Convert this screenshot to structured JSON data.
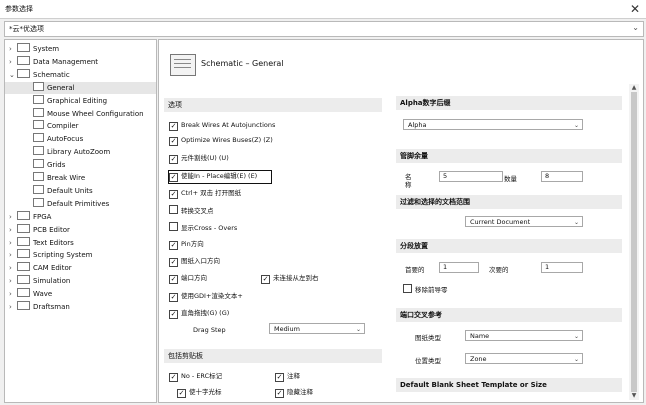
{
  "window": {
    "title": "参数选择",
    "close_glyph": "✕"
  },
  "search": {
    "value": "*云*优选项",
    "dropdown": "⌄"
  },
  "tree": {
    "items": [
      {
        "label": "System",
        "level": 0,
        "expanded": false,
        "kind": "folder"
      },
      {
        "label": "Data Management",
        "level": 0,
        "expanded": false,
        "kind": "folder"
      },
      {
        "label": "Schematic",
        "level": 0,
        "expanded": true,
        "kind": "folder"
      },
      {
        "label": "General",
        "level": 1,
        "kind": "page",
        "selected": true
      },
      {
        "label": "Graphical Editing",
        "level": 1,
        "kind": "page"
      },
      {
        "label": "Mouse Wheel Configuration",
        "level": 1,
        "kind": "page"
      },
      {
        "label": "Compiler",
        "level": 1,
        "kind": "page"
      },
      {
        "label": "AutoFocus",
        "level": 1,
        "kind": "page"
      },
      {
        "label": "Library AutoZoom",
        "level": 1,
        "kind": "page"
      },
      {
        "label": "Grids",
        "level": 1,
        "kind": "page"
      },
      {
        "label": "Break Wire",
        "level": 1,
        "kind": "page"
      },
      {
        "label": "Default Units",
        "level": 1,
        "kind": "page"
      },
      {
        "label": "Default Primitives",
        "level": 1,
        "kind": "page"
      },
      {
        "label": "FPGA",
        "level": 0,
        "expanded": false,
        "kind": "folder"
      },
      {
        "label": "PCB Editor",
        "level": 0,
        "expanded": false,
        "kind": "folder"
      },
      {
        "label": "Text Editors",
        "level": 0,
        "expanded": false,
        "kind": "folder"
      },
      {
        "label": "Scripting System",
        "level": 0,
        "expanded": false,
        "kind": "folder"
      },
      {
        "label": "CAM Editor",
        "level": 0,
        "expanded": false,
        "kind": "folder"
      },
      {
        "label": "Simulation",
        "level": 0,
        "expanded": false,
        "kind": "folder"
      },
      {
        "label": "Wave",
        "level": 0,
        "expanded": false,
        "kind": "folder"
      },
      {
        "label": "Draftsman",
        "level": 0,
        "expanded": false,
        "kind": "folder"
      }
    ]
  },
  "panel": {
    "title": "Schematic – General",
    "options": {
      "header": "选项",
      "checkboxes": [
        {
          "label": "Break Wires At Autojunctions",
          "checked": true
        },
        {
          "label": "Optimize Wires Buses(Z) (Z)",
          "checked": true
        },
        {
          "label": "元件割线(U) (U)",
          "checked": true
        },
        {
          "label": "使能In - Place编辑(E) (E)",
          "checked": true
        },
        {
          "label": "Ctrl+ 双击 打开图纸",
          "checked": true
        },
        {
          "label": "转换交叉点",
          "checked": false
        },
        {
          "label": "显示Cross - Overs",
          "checked": false
        },
        {
          "label": "Pin方向",
          "checked": true
        },
        {
          "label": "图纸入口方向",
          "checked": true
        },
        {
          "label": "端口方向",
          "checked": true
        },
        {
          "label": "未连接从左到右",
          "checked": true
        },
        {
          "label": "使用GDI+渲染文本+",
          "checked": true
        },
        {
          "label": "直角拖拽(G) (G)",
          "checked": true
        }
      ],
      "drag_step_label": "Drag Step",
      "drag_step_value": "Medium"
    },
    "clipboard": {
      "header": "包括剪贴板",
      "checkboxes": [
        {
          "label": "No - ERC标记",
          "checked": true
        },
        {
          "label": "注释",
          "checked": true
        },
        {
          "label": "使十字光标",
          "checked": true
        },
        {
          "label": "隐藏注释",
          "checked": true
        }
      ]
    },
    "alpha": {
      "header": "Alpha数字后缀",
      "value": "Alpha"
    },
    "pin_margin": {
      "header": "管脚余量",
      "name_label": "名称",
      "name_value": "5",
      "number_label": "数量",
      "number_value": "8"
    },
    "filter": {
      "header": "过滤和选择的文档范围",
      "value": "Current Document"
    },
    "increment": {
      "header": "分段放置",
      "primary_label": "首要的",
      "primary_value": "1",
      "secondary_label": "次要的",
      "secondary_value": "1",
      "remove_leading_zero": "移除前导零",
      "remove_leading_zero_checked": false
    },
    "port_ref": {
      "header": "端口交叉参考",
      "sheet_type_label": "图纸类型",
      "sheet_type_value": "Name",
      "location_label": "位置类型",
      "location_value": "Zone"
    },
    "default_sheet": {
      "header": "Default Blank Sheet Template or Size"
    }
  },
  "glyphs": {
    "check": "✓",
    "chevron": "⌄",
    "expand": "›",
    "collapse": "⌄",
    "up": "▲",
    "down": "▼"
  }
}
